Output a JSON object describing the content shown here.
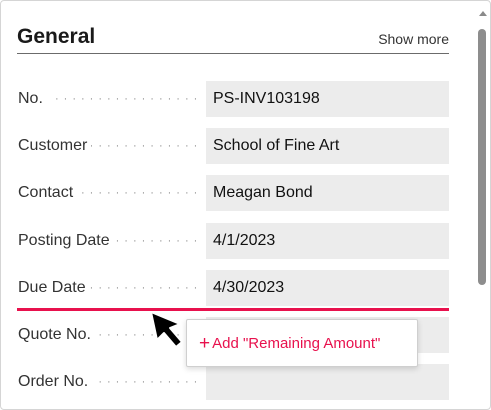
{
  "section": {
    "title": "General",
    "show_more_label": "Show more"
  },
  "fields": [
    {
      "label": "No.",
      "value": "PS-INV103198"
    },
    {
      "label": "Customer",
      "value": "School of Fine Art"
    },
    {
      "label": "Contact",
      "value": "Meagan Bond"
    },
    {
      "label": "Posting Date",
      "value": "4/1/2023"
    },
    {
      "label": "Due Date",
      "value": "4/30/2023"
    },
    {
      "label": "Quote No.",
      "value": ""
    },
    {
      "label": "Order No.",
      "value": ""
    }
  ],
  "tooltip": {
    "plus": "+",
    "text": "Add \"Remaining Amount\""
  },
  "colors": {
    "accent": "#e8114d",
    "field_bg": "#ececec"
  },
  "icons": {
    "cursor": "arrow-cursor-icon",
    "scroll_up": "chevron-up-icon"
  }
}
